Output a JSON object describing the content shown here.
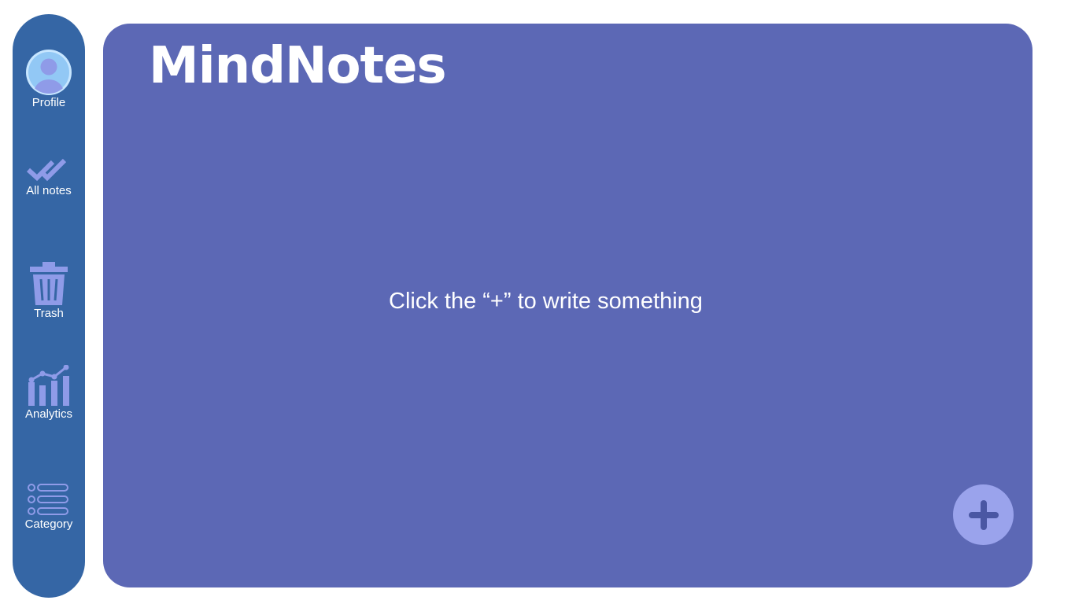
{
  "app": {
    "title": "MindNotes"
  },
  "sidebar": {
    "items": [
      {
        "label": "Profile",
        "icon": "profile-icon"
      },
      {
        "label": "All notes",
        "icon": "double-check-icon"
      },
      {
        "label": "Trash",
        "icon": "trash-icon"
      },
      {
        "label": "Analytics",
        "icon": "analytics-icon"
      },
      {
        "label": "Category",
        "icon": "list-icon"
      }
    ]
  },
  "main": {
    "empty_message": "Click the “+” to write something",
    "add_button": {
      "icon": "plus-icon"
    }
  },
  "colors": {
    "sidebar_bg": "#3566a5",
    "main_bg": "#5c68b5",
    "icon_accent": "#8f9be8",
    "add_button_bg": "#9aa3ec",
    "text": "#ffffff"
  }
}
